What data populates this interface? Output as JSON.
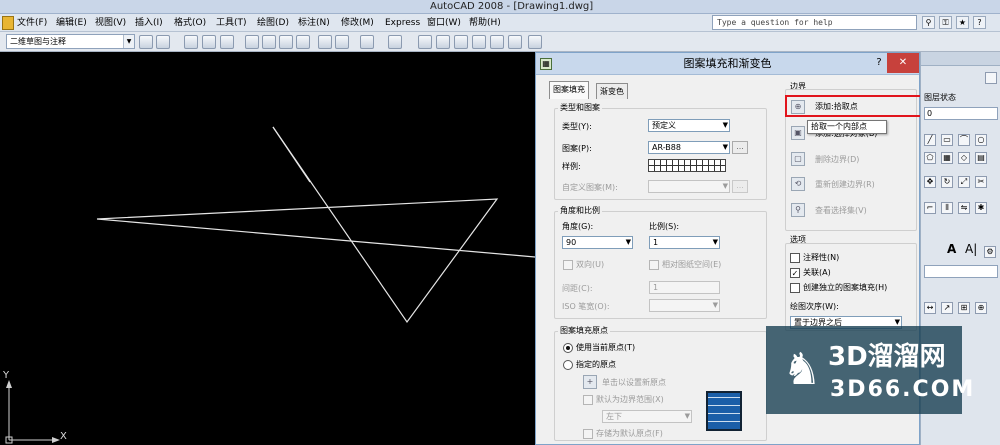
{
  "window": {
    "title": "AutoCAD 2008 - [Drawing1.dwg]",
    "question_placeholder": "Type a question for help"
  },
  "menu": [
    {
      "label": "文件(F)"
    },
    {
      "label": "编辑(E)"
    },
    {
      "label": "视图(V)"
    },
    {
      "label": "插入(I)"
    },
    {
      "label": "格式(O)"
    },
    {
      "label": "工具(T)"
    },
    {
      "label": "绘图(D)"
    },
    {
      "label": "标注(N)"
    },
    {
      "label": "修改(M)"
    },
    {
      "label": "Express"
    },
    {
      "label": "窗口(W)"
    },
    {
      "label": "帮助(H)"
    }
  ],
  "workspace": {
    "value": "二维草图与注释"
  },
  "ucs": {
    "y": "Y",
    "x": "X"
  },
  "dialog": {
    "title": "图案填充和渐变色",
    "help": "?",
    "close": "✕",
    "tabs": [
      {
        "label": "图案填充",
        "active": true
      },
      {
        "label": "渐变色",
        "active": false
      }
    ],
    "type_pattern": {
      "group": "类型和图案",
      "type_label": "类型(Y):",
      "type_value": "预定义",
      "pattern_label": "图案(P):",
      "pattern_value": "AR-B88",
      "swatch_label": "样例:",
      "custom_label": "自定义图案(M):",
      "dots": "..."
    },
    "angle_scale": {
      "group": "角度和比例",
      "angle_label": "角度(G):",
      "angle_value": "90",
      "scale_label": "比例(S):",
      "scale_value": "1",
      "double": "双向(U)",
      "relative": "相对图纸空间(E)",
      "spacing_label": "间距(C):",
      "spacing_value": "1",
      "iso_label": "ISO 笔宽(O):"
    },
    "origin": {
      "group": "图案填充原点",
      "use_current": "使用当前原点(T)",
      "specified": "指定的原点",
      "click_set": "单击以设置新原点",
      "default_boundary": "默认为边界范围(X)",
      "position": "左下",
      "store_default": "存储为默认原点(F)"
    },
    "boundary": {
      "group": "边界",
      "add_pick": "添加:拾取点",
      "add_select": "添加:选择对象(B)",
      "remove": "删除边界(D)",
      "recreate": "重新创建边界(R)",
      "view_selection": "查看选择集(V)"
    },
    "options": {
      "group": "选项",
      "annotative": "注释性(N)",
      "associative": "关联(A)",
      "associative_checked": true,
      "separate": "创建独立的图案填充(H)",
      "draw_order_label": "绘图次序(W):",
      "draw_order_value": "置于边界之后"
    }
  },
  "tooltip": "拾取一个内部点",
  "right_panel": {
    "layer_state": "图层状态",
    "layer_value": "0",
    "text_a": "A",
    "text_aa": "A|"
  },
  "watermark": {
    "cn": "3D溜溜网",
    "en": "3D66.COM"
  }
}
